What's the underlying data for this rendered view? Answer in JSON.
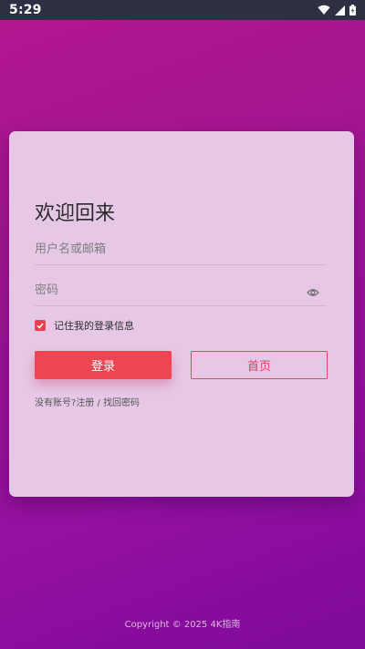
{
  "status_bar": {
    "time": "5:29",
    "icons": [
      "wifi-icon",
      "signal-icon",
      "battery-icon"
    ]
  },
  "login_card": {
    "title": "欢迎回来",
    "username_placeholder": "用户名或邮箱",
    "password_placeholder": "密码",
    "remember_label": "记住我的登录信息",
    "remember_checked": true,
    "login_button": "登录",
    "home_button": "首页",
    "no_account_text": "没有账号?",
    "register_link": "注册",
    "separator": " / ",
    "forgot_link": "找回密码"
  },
  "footer": {
    "copyright": "Copyright © 2025 4K指南"
  },
  "colors": {
    "accent": "#ef4452",
    "card_background": "#e6c8e6",
    "status_bar": "#2d2f43"
  }
}
